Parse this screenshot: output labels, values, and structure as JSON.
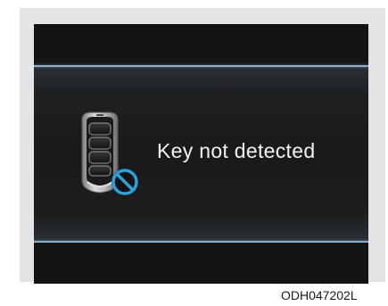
{
  "display": {
    "message": "Key not detected",
    "icon": "smart-key-prohibited-icon"
  },
  "figure": {
    "reference_code": "ODH047202L"
  },
  "colors": {
    "screen_background": "#121212",
    "accent_line": "#8fb0c8",
    "prohibited_symbol": "#2aa3dc",
    "text": "#f2f2f2"
  }
}
